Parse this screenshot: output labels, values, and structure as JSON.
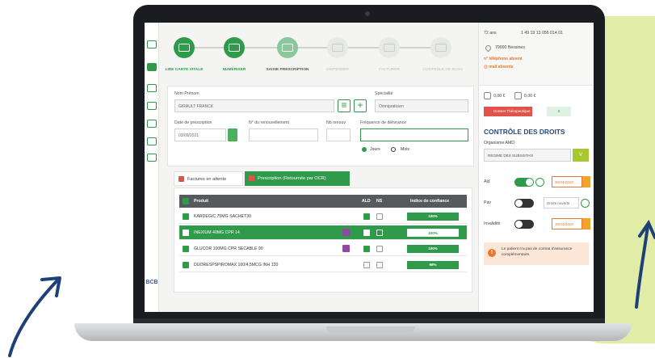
{
  "steps": [
    {
      "label": "LIRE CARTE VITALE"
    },
    {
      "label": "NUMÉRISER"
    },
    {
      "label": "SAISIE PRESCRIPTION"
    },
    {
      "label": "DISPENSER"
    },
    {
      "label": "FACTURER"
    },
    {
      "label": "CONTRÔLE DE SCAN"
    }
  ],
  "prescriber": {
    "name_label": "Nom Prénom",
    "name_value": "GIRAULT FRANCK",
    "specialty_label": "Spécialité",
    "specialty_value": "Omnipraticien",
    "date_label": "Date de prescription",
    "date_value": "03/09/2021",
    "renewal_label": "N° du renouvellement",
    "renewals_label": "Nb renouv",
    "frequency_label": "Fréquence de délivrance",
    "radio_days": "Jours",
    "radio_month": "Mois"
  },
  "tabs": {
    "invoices": "Factures en attente",
    "prescription": "Prescription (Retournée par OCR)"
  },
  "table": {
    "headers": {
      "product": "Produit",
      "ald": "ALD",
      "ns": "NS",
      "confidence": "Indice de confiance"
    },
    "rows": [
      {
        "name": "KARDEGIC 75MG SACHET30",
        "confidence": "100%",
        "badge": false,
        "ald": true,
        "ns": false
      },
      {
        "name": "INEXIUM 40MG CPR 14",
        "confidence": "100%",
        "badge": true,
        "ald": true,
        "ns": false
      },
      {
        "name": "GLUCOR 100MG CPR SECABLE 90",
        "confidence": "100%",
        "badge": true,
        "ald": true,
        "ns": false
      },
      {
        "name": "DUORESPSPIROMAX 160/4,5MCG INH 120",
        "confidence": "98%",
        "badge": false,
        "ald": false,
        "ns": false
      }
    ]
  },
  "patient": {
    "age": "72 ans",
    "phone": "1 49 19 13 055 014 01",
    "address": "79000 Bessines",
    "phone_missing": "n° téléphone absent",
    "mail_missing": "@ mail absente",
    "amount_1": "0,00 €",
    "amount_2": "0,00 €",
    "therapeutic_file": "Dossier Thérapeutique",
    "small_pill": "0"
  },
  "rights": {
    "title": "CONTRÔLE DES DROITS",
    "amo_label": "Organisme AMO",
    "amo_value": "REGIME DES SUBSISTAN",
    "amo_btn": "V",
    "ald_label": "Ald",
    "ald_date": "30/04/2022",
    "pav_label": "Pav",
    "pav_value": "Droits ouverts",
    "invalidite_label": "Invalidité",
    "invalidite_date": "30/04/2022",
    "info": "Le patient n'a pas de contrat d'assurance complémentaire."
  },
  "brand": {
    "bcb": "BCB"
  },
  "colors": {
    "primary": "#2e9a4a",
    "accent": "#e8772e",
    "alert": "#e0534a",
    "navy": "#2a4a78"
  }
}
